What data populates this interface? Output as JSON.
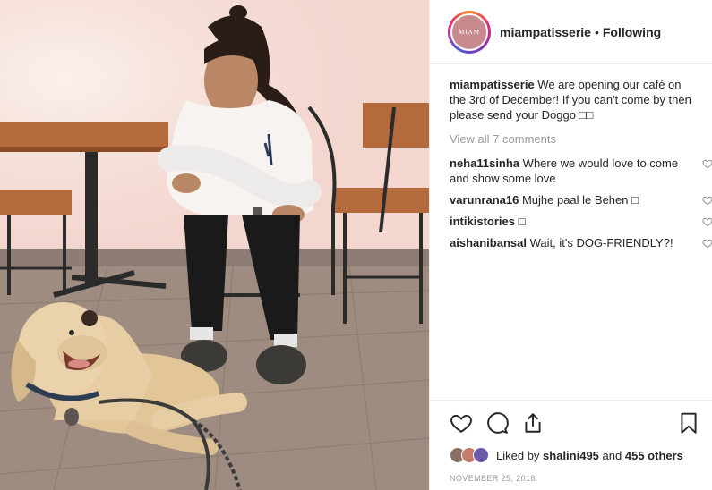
{
  "header": {
    "avatar_text": "MIAM",
    "username": "miampatisserie",
    "separator": "•",
    "follow_status": "Following"
  },
  "caption": {
    "username": "miampatisserie",
    "text": "We are opening our café on the 3rd of December! If you can't come by then please send your Doggo □□"
  },
  "view_all_comments": "View all 7 comments",
  "comments": [
    {
      "username": "neha11sinha",
      "text": "Where we would love to come and show some love"
    },
    {
      "username": "varunrana16",
      "text": "Mujhe paal le Behen □"
    },
    {
      "username": "intikistories",
      "text": "□"
    },
    {
      "username": "aishanibansal",
      "text": "Wait, it's DOG-FRIENDLY?!"
    }
  ],
  "icons": [
    "heart-icon",
    "comment-icon",
    "share-icon",
    "bookmark-icon"
  ],
  "likes": {
    "prefix": "Liked by",
    "user": "shalini495",
    "conjunction": "and",
    "others": "455 others"
  },
  "date": "NOVEMBER 25, 2018",
  "colors": {
    "text": "#262626",
    "muted": "#999999",
    "border": "#efefef",
    "wall": "#f6e0d9",
    "floor": "#9c8a7e"
  }
}
